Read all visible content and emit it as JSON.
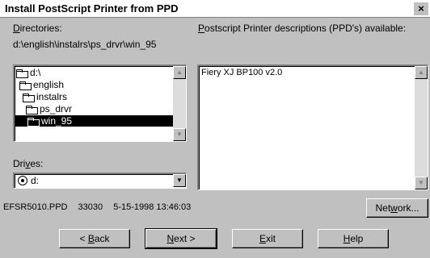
{
  "window": {
    "title": "Install PostScript Printer from PPD",
    "close_label": "×"
  },
  "directories": {
    "label_acc": "D",
    "label_rest": "irectories:",
    "current_path": "d:\\english\\instalrs\\ps_drvr\\win_95",
    "items": [
      {
        "label": "d:\\",
        "selected": false
      },
      {
        "label": "english",
        "selected": false
      },
      {
        "label": "instalrs",
        "selected": false
      },
      {
        "label": "ps_drvr",
        "selected": false
      },
      {
        "label": "win_95",
        "selected": true
      }
    ]
  },
  "ppd": {
    "label_acc": "P",
    "label_rest": "ostscript Printer descriptions (PPD's) available:",
    "items": [
      "Fiery XJ BP100 v2.0"
    ]
  },
  "drives": {
    "label_pre": "Dri",
    "label_acc": "v",
    "label_post": "es:",
    "selected": "d:"
  },
  "status": {
    "filename": "EFSR5010.PPD",
    "size": "33030",
    "date": "5-15-1998 13:46:03"
  },
  "buttons": {
    "network": {
      "pre": "Net",
      "acc": "w",
      "post": "ork..."
    },
    "back": {
      "pre": "< ",
      "acc": "B",
      "post": "ack"
    },
    "next": {
      "pre": "",
      "acc": "N",
      "post": "ext >"
    },
    "exit": {
      "pre": "",
      "acc": "E",
      "post": "xit"
    },
    "help": {
      "pre": "",
      "acc": "H",
      "post": "elp"
    }
  },
  "icons": {
    "folder": "folder-icon",
    "drive": "drive-icon",
    "scroll_up": "▲",
    "scroll_down": "▼",
    "combo_arrow": "▼"
  }
}
